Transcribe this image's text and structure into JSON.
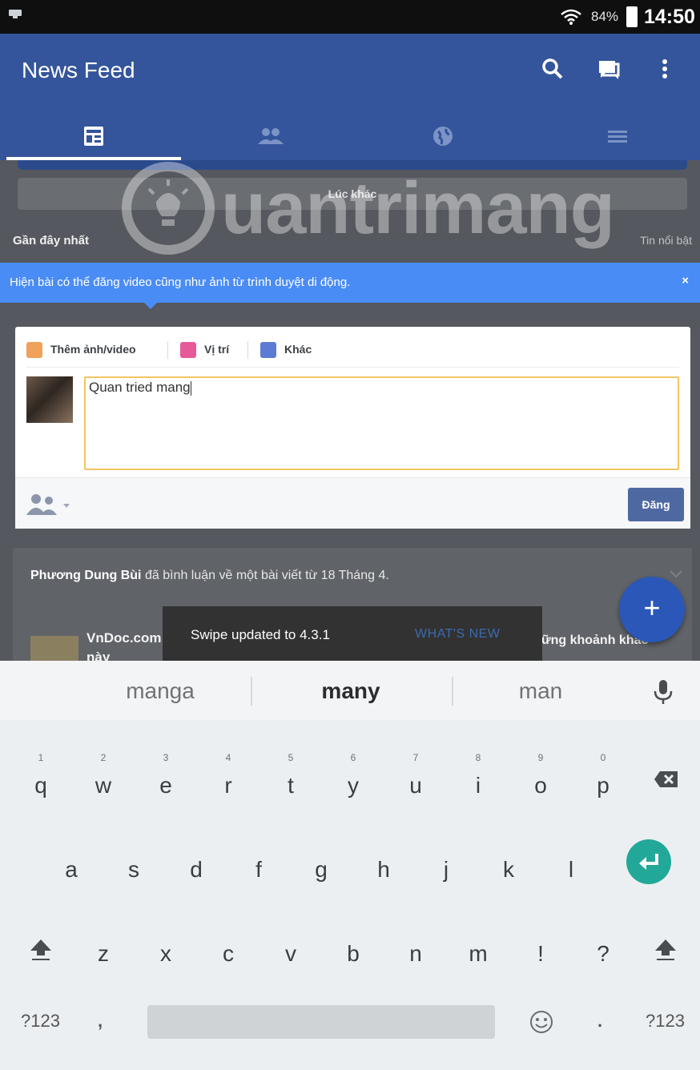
{
  "status_bar": {
    "battery": "84%",
    "time": "14:50"
  },
  "app_bar": {
    "title": "News Feed",
    "actions": [
      "search-icon",
      "messages-icon",
      "more-vert-icon"
    ],
    "tabs": [
      "news-feed-icon",
      "friends-icon",
      "notifications-globe-icon",
      "menu-icon"
    ],
    "active_tab": 0
  },
  "feed": {
    "later_button": "Lúc khác",
    "recent_label": "Gần đây nhất",
    "featured_label": "Tin nổi bật",
    "watermark": "uantrimang"
  },
  "banner": {
    "text": "Hiện bài có thể đăng video cũng như ảnh từ trình duyệt di động.",
    "close": "×"
  },
  "composer": {
    "tools": [
      {
        "label": "Thêm ảnh/video",
        "icon": "photo-icon",
        "color": "#f0a15a"
      },
      {
        "label": "Vị trí",
        "icon": "location-icon",
        "color": "#e65a9a"
      },
      {
        "label": "Khác",
        "icon": "emoji-icon",
        "color": "#5b7bd5"
      }
    ],
    "input_value": "Quan tried mang",
    "post_button": "Đăng"
  },
  "story": {
    "author": "Phương Dung Bùi",
    "action": "đã bình luận về một bài viết từ 18 Tháng 4.",
    "page_name": "VnDoc.com",
    "page_name_cont": "này",
    "right_text": "ững khoảnh khắc"
  },
  "snackbar": {
    "message": "Swipe updated to 4.3.1",
    "action": "WHAT'S NEW"
  },
  "fab": {
    "label": "+"
  },
  "keyboard": {
    "suggestions": [
      "manga",
      "many",
      "man"
    ],
    "row1": [
      {
        "ch": "q",
        "n": "1"
      },
      {
        "ch": "w",
        "n": "2"
      },
      {
        "ch": "e",
        "n": "3"
      },
      {
        "ch": "r",
        "n": "4"
      },
      {
        "ch": "t",
        "n": "5"
      },
      {
        "ch": "y",
        "n": "6"
      },
      {
        "ch": "u",
        "n": "7"
      },
      {
        "ch": "i",
        "n": "8"
      },
      {
        "ch": "o",
        "n": "9"
      },
      {
        "ch": "p",
        "n": "0"
      }
    ],
    "row2": [
      "a",
      "s",
      "d",
      "f",
      "g",
      "h",
      "j",
      "k",
      "l"
    ],
    "row3": [
      "z",
      "x",
      "c",
      "v",
      "b",
      "n",
      "m",
      "!",
      "?"
    ],
    "bottom": {
      "symbols_left": "?123",
      "comma": ",",
      "period": ".",
      "symbols_right": "?123"
    }
  },
  "colors": {
    "facebook_blue": "#34559b",
    "banner_blue": "#4a8cf5",
    "fab_blue": "#2a57b8",
    "enter_teal": "#22a898"
  }
}
